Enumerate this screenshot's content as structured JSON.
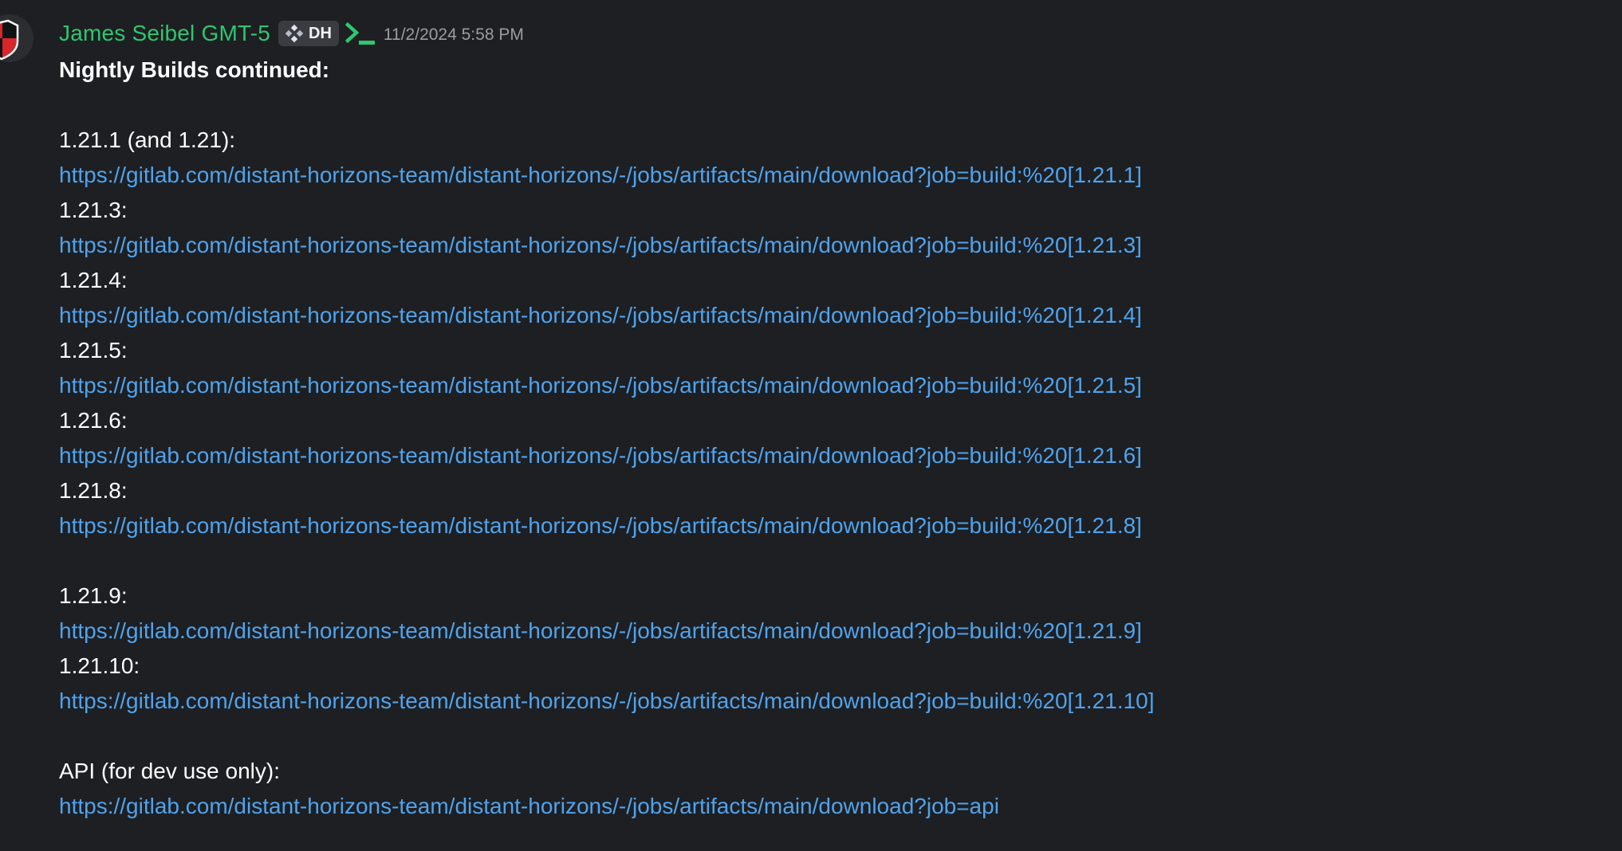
{
  "message": {
    "author": "James Seibel GMT-5",
    "author_color": "#2dc770",
    "server_tag": "DH",
    "timestamp": "11/2/2024 5:58 PM",
    "avatar_icon": "red-black-shield-icon",
    "tag_icon": "diamond-cross-icon",
    "badge_icon": "terminal-prompt-icon"
  },
  "content": {
    "heading": "Nightly Builds continued:",
    "builds_a": [
      {
        "label": "1.21.1 (and 1.21):",
        "url": "https://gitlab.com/distant-horizons-team/distant-horizons/-/jobs/artifacts/main/download?job=build:%20[1.21.1]"
      },
      {
        "label": "1.21.3:",
        "url": "https://gitlab.com/distant-horizons-team/distant-horizons/-/jobs/artifacts/main/download?job=build:%20[1.21.3]"
      },
      {
        "label": "1.21.4:",
        "url": "https://gitlab.com/distant-horizons-team/distant-horizons/-/jobs/artifacts/main/download?job=build:%20[1.21.4]"
      },
      {
        "label": "1.21.5:",
        "url": "https://gitlab.com/distant-horizons-team/distant-horizons/-/jobs/artifacts/main/download?job=build:%20[1.21.5]"
      },
      {
        "label": "1.21.6:",
        "url": "https://gitlab.com/distant-horizons-team/distant-horizons/-/jobs/artifacts/main/download?job=build:%20[1.21.6]"
      },
      {
        "label": "1.21.8:",
        "url": "https://gitlab.com/distant-horizons-team/distant-horizons/-/jobs/artifacts/main/download?job=build:%20[1.21.8]"
      }
    ],
    "builds_b": [
      {
        "label": "1.21.9:",
        "url": "https://gitlab.com/distant-horizons-team/distant-horizons/-/jobs/artifacts/main/download?job=build:%20[1.21.9]"
      },
      {
        "label": "1.21.10:",
        "url": "https://gitlab.com/distant-horizons-team/distant-horizons/-/jobs/artifacts/main/download?job=build:%20[1.21.10]"
      }
    ],
    "api": {
      "label": "API (for dev use only):",
      "url": "https://gitlab.com/distant-horizons-team/distant-horizons/-/jobs/artifacts/main/download?job=api"
    }
  },
  "colors": {
    "background": "#1e1f22",
    "text": "#ffffff",
    "link": "#4fa3ed",
    "timestamp": "#9a9ca3",
    "tag_background": "#3a3c42"
  }
}
